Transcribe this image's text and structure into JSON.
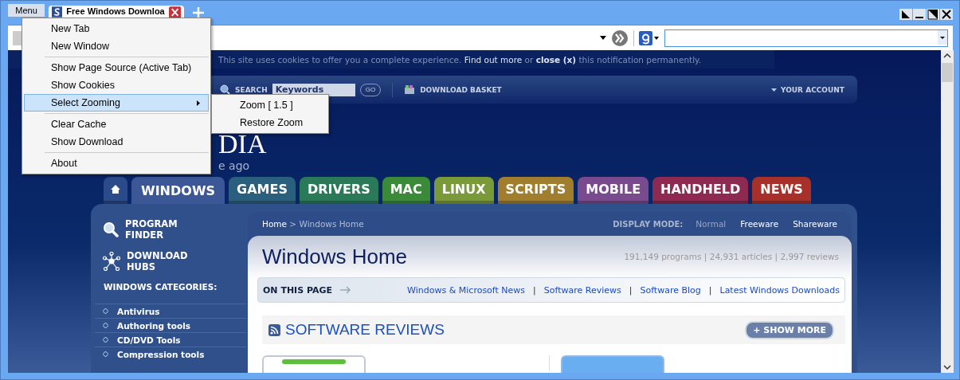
{
  "menu_button": "Menu",
  "tabs": [
    {
      "title": "Free Windows Downloa",
      "selected": true
    }
  ],
  "page": {
    "cookie_notice": {
      "text": "This site uses cookies to offer you a complete experience.",
      "find_out_more": "Find out more",
      "joiner": "or",
      "close": "close (x)",
      "tail": "this notification permanently."
    },
    "nav": {
      "search_label": "SEARCH",
      "search_placeholder": "Keywords",
      "go": "GO",
      "basket": "DOWNLOAD BASKET",
      "account": "YOUR ACCOUNT"
    },
    "logo_fragment": "DIA",
    "tagline_fragment": "e ago",
    "section_tabs": [
      {
        "label": "WINDOWS",
        "color": "#3b5796",
        "selected": true
      },
      {
        "label": "GAMES",
        "color": "#2b5f7e",
        "selected": false
      },
      {
        "label": "DRIVERS",
        "color": "#2a7a5a",
        "selected": false
      },
      {
        "label": "MAC",
        "color": "#3a8a3a",
        "selected": false
      },
      {
        "label": "LINUX",
        "color": "#7a9a3a",
        "selected": false
      },
      {
        "label": "SCRIPTS",
        "color": "#a07e2e",
        "selected": false
      },
      {
        "label": "MOBILE",
        "color": "#7a4a8e",
        "selected": false
      },
      {
        "label": "HANDHELD",
        "color": "#8e2a52",
        "selected": false
      },
      {
        "label": "NEWS",
        "color": "#a8302a",
        "selected": false
      }
    ],
    "sidebar": {
      "links": [
        {
          "kind": "finder",
          "label": "PROGRAM FINDER"
        },
        {
          "kind": "hubs",
          "label": "DOWNLOAD HUBS"
        }
      ],
      "categories_heading": "WINDOWS CATEGORIES:",
      "categories": [
        "Antivirus",
        "Authoring tools",
        "CD/DVD Tools",
        "Compression tools"
      ]
    },
    "breadcrumb": {
      "home": "Home",
      "rest": "> Windows Home"
    },
    "display_mode": {
      "label": "DISPLAY MODE:",
      "options": [
        {
          "label": "Normal",
          "selected": true
        },
        {
          "label": "Freeware",
          "selected": false
        },
        {
          "label": "Shareware",
          "selected": false
        }
      ]
    },
    "heading": "Windows Home",
    "stats": "191,149 programs | 24,931 articles | 2,997 reviews",
    "on_this_page": {
      "label": "ON THIS PAGE",
      "separator": "|",
      "links": [
        "Windows & Microsoft News",
        "Software Reviews",
        "Software Blog",
        "Latest Windows Downloads"
      ]
    },
    "reviews": {
      "title": "SOFTWARE REVIEWS",
      "show_more": "+ SHOW MORE"
    }
  },
  "context_menu": {
    "groups": [
      [
        {
          "label": "New Tab",
          "selected": false,
          "has_submenu": false
        },
        {
          "label": "New Window",
          "selected": false,
          "has_submenu": false
        }
      ],
      [
        {
          "label": "Show Page Source (Active Tab)",
          "selected": false,
          "has_submenu": false
        },
        {
          "label": "Show Cookies",
          "selected": false,
          "has_submenu": false
        },
        {
          "label": "Select Zooming",
          "selected": true,
          "has_submenu": true
        }
      ],
      [
        {
          "label": "Clear Cache",
          "selected": false,
          "has_submenu": false
        },
        {
          "label": "Show Download",
          "selected": false,
          "has_submenu": false
        }
      ],
      [
        {
          "label": "About",
          "selected": false,
          "has_submenu": false
        }
      ]
    ],
    "submenu": [
      "Zoom [ 1.5 ]",
      "Restore Zoom"
    ]
  }
}
